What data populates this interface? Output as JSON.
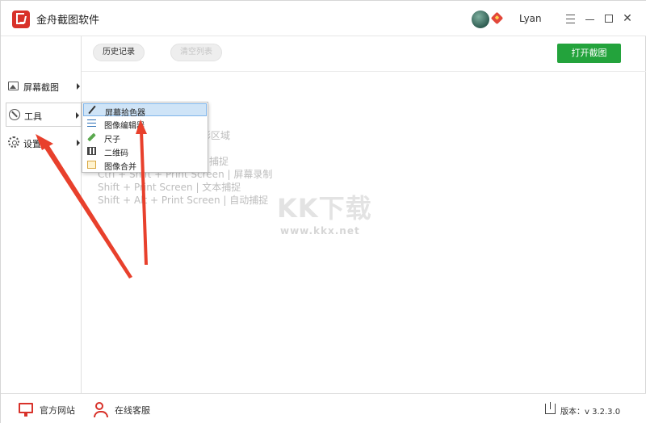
{
  "app": {
    "title": "金舟截图软件",
    "username": "Lyan"
  },
  "window_controls": {
    "menu": "☰",
    "minimize": "—",
    "maximize": "□",
    "close": "✕"
  },
  "sidebar": {
    "items": [
      {
        "label": "屏幕截图",
        "icon": "image-icon"
      },
      {
        "label": "工具",
        "icon": "wrench-icon"
      },
      {
        "label": "设置",
        "icon": "gear-icon"
      }
    ]
  },
  "toolbar": {
    "history_label": "历史记录",
    "clear_list_label": "清空列表",
    "open_screenshot_label": "打开截图"
  },
  "dropdown": {
    "items": [
      {
        "label": "屏幕拾色器",
        "icon": "color-picker-icon"
      },
      {
        "label": "图像编辑器",
        "icon": "image-editor-icon"
      },
      {
        "label": "尺子",
        "icon": "ruler-icon"
      },
      {
        "label": "二维码",
        "icon": "qr-code-icon"
      },
      {
        "label": "图像合并",
        "icon": "image-merge-icon"
      }
    ]
  },
  "hints": [
    "形区域",
    "捕捉",
    "Ctrl + Shift + Print Screen  |  屏幕录制",
    "Shift + Print Screen  |  文本捕捉",
    "Shift + Alt + Print Screen  |  自动捕捉"
  ],
  "watermark": {
    "text": "KK下载",
    "url": "www.kkx.net"
  },
  "footer": {
    "official_site_label": "官方网站",
    "online_service_label": "在线客服",
    "version_label": "版本：v 3.2.3.0"
  },
  "colors": {
    "brand": "#d8322a",
    "primary_button": "#23a33c",
    "highlight": "#cfe4f7",
    "annotation_arrow": "#e8402c"
  }
}
